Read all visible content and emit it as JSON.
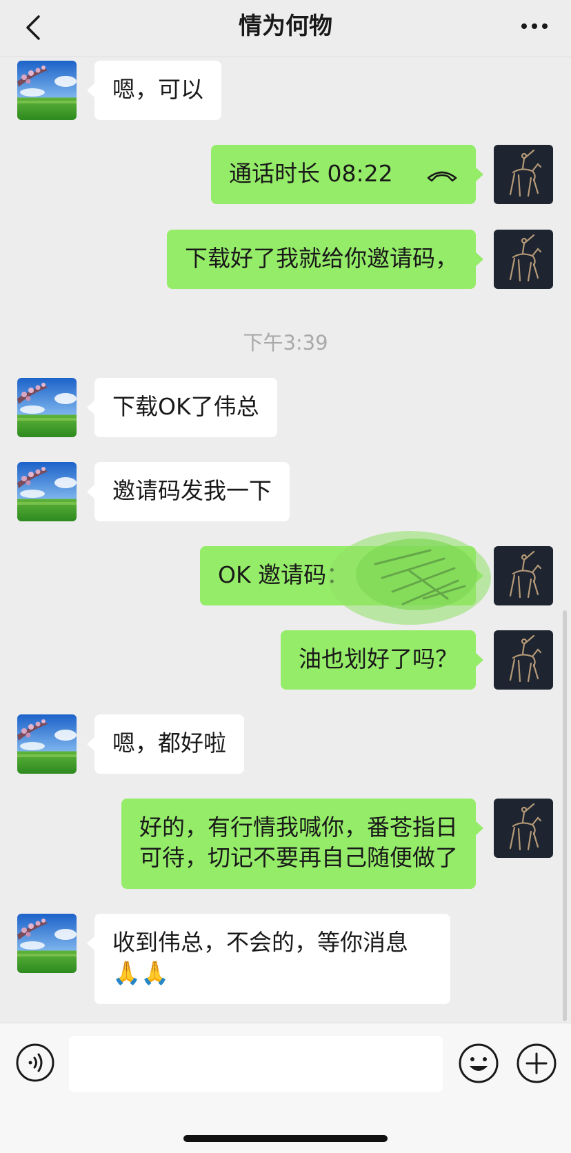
{
  "header": {
    "title": "情为何物",
    "back_icon": "chevron-left-icon",
    "more_icon": "more-dots-icon"
  },
  "messages": [
    {
      "side": "left",
      "text": "嗯，可以"
    },
    {
      "side": "right",
      "call_label": "通话时长 08:22",
      "icon": "phone-hangup-icon"
    },
    {
      "side": "right",
      "text": "下载好了我就给你邀请码，"
    },
    {
      "timestamp": "下午3:39"
    },
    {
      "side": "left",
      "text": "下载OK了伟总"
    },
    {
      "side": "left",
      "text": "邀请码发我一下"
    },
    {
      "side": "right",
      "text": "OK 邀请码："
    },
    {
      "side": "right",
      "text": "油也划好了吗？"
    },
    {
      "side": "left",
      "text": "嗯，都好啦"
    },
    {
      "side": "right",
      "line1": "好的，有行情我喊你，番苍指日",
      "line2": "可待，切记不要再自己随便做了"
    },
    {
      "side": "left",
      "line1": "收到伟总，不会的，等你消息",
      "emoji": "🙏🙏"
    }
  ],
  "input_bar": {
    "voice_icon": "voice-icon",
    "text_value": "",
    "emoji_icon": "emoji-icon",
    "plus_icon": "plus-icon"
  },
  "colors": {
    "background": "#ededed",
    "sent_bubble": "#95ec69",
    "received_bubble": "#ffffff",
    "timestamp": "#a9a9a9"
  }
}
